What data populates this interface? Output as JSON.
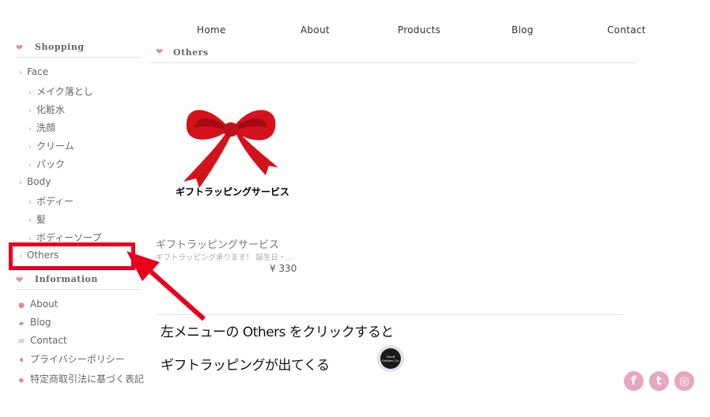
{
  "nav": {
    "home": "Home",
    "about": "About",
    "products": "Products",
    "blog": "Blog",
    "contact": "Contact"
  },
  "sidebar": {
    "shopping_heading": "Shopping",
    "face": "Face",
    "face_items": [
      "メイク落とし",
      "化粧水",
      "洗顔",
      "クリーム",
      "パック"
    ],
    "body": "Body",
    "body_items": [
      "ボディー",
      "髪",
      "ボディーソープ"
    ],
    "others": "Others",
    "info_heading": "Information",
    "info_items": [
      {
        "icon": "info-icon",
        "label": "About"
      },
      {
        "icon": "book-icon",
        "label": "Blog"
      },
      {
        "icon": "mail-icon",
        "label": "Contact"
      },
      {
        "icon": "person-icon",
        "label": "プライバシーポリシー"
      },
      {
        "icon": "tag-icon",
        "label": "特定商取引法に基づく表記"
      }
    ]
  },
  "main": {
    "heading": "Others",
    "product": {
      "image_label": "ギフトラッピングサービス",
      "name": "ギフトラッピングサービス",
      "description": "ギフトラッピング承ります！ 誕生日・...",
      "price": "¥ 330"
    }
  },
  "annotation": {
    "line1": "左メニューの Others をクリックすると",
    "line2": "ギフトラッピングが出てくる",
    "color": "#e8001c"
  },
  "badge": {
    "text": "Good Virtues Co."
  },
  "social": {
    "facebook": "f",
    "twitter": "t",
    "instagram": "◎",
    "color": "#e8a6bf"
  }
}
